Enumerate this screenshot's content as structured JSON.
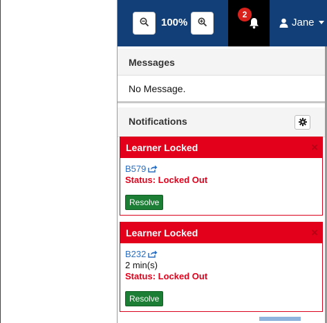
{
  "topbar": {
    "zoom_level": "100%",
    "notification_count": "2",
    "user_name": "Jane"
  },
  "messages": {
    "title": "Messages",
    "empty_text": "No Message."
  },
  "notifications": {
    "title": "Notifications",
    "items": [
      {
        "title": "Learner Locked",
        "learner": "B579",
        "time": "",
        "status": "Status: Locked Out",
        "action": "Resolve"
      },
      {
        "title": "Learner Locked",
        "learner": "B232",
        "time": "2 min(s)",
        "status": "Status: Locked Out",
        "action": "Resolve"
      }
    ]
  },
  "colors": {
    "topbar": "#123f77",
    "alert_red": "#e3001b",
    "resolve_green": "#1c7d34",
    "link_blue": "#2a6fc2"
  },
  "icons": [
    "zoom-out-icon",
    "zoom-in-icon",
    "bell-icon",
    "user-icon",
    "caret-down-icon",
    "gear-icon",
    "external-link-icon",
    "close-icon"
  ]
}
